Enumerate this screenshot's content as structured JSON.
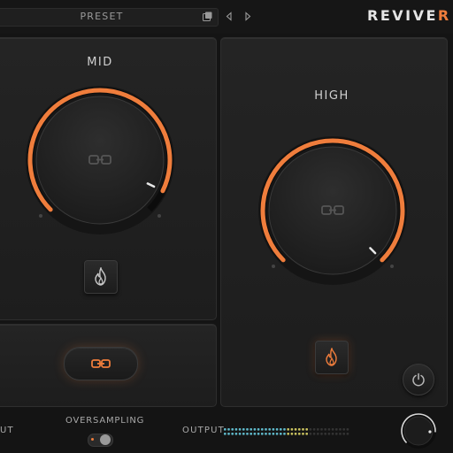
{
  "header": {
    "preset_label": "PRESET",
    "logo_main": "REVIVE",
    "logo_accent": "R",
    "icons": [
      "preset-open-icon",
      "previous-preset-icon",
      "next-preset-icon"
    ]
  },
  "bands": {
    "mid": {
      "label": "MID",
      "knob_value": 0.93,
      "fire_enabled": false
    },
    "high": {
      "label": "HIGH",
      "knob_value": 1.0,
      "fire_enabled": true
    }
  },
  "link_toggle": {
    "enabled": true,
    "icon": "link-icon"
  },
  "power_button": {
    "icon": "power-icon"
  },
  "footer": {
    "input_label_tail": "UT",
    "oversampling_label": "OVERSAMPLING",
    "oversampling_enabled": true,
    "output_label": "OUTPUT",
    "output_level": 0.85
  },
  "colors": {
    "accent": "#ef7d3c",
    "background": "#141414",
    "panel": "#222222",
    "text": "#d0d0d0"
  }
}
